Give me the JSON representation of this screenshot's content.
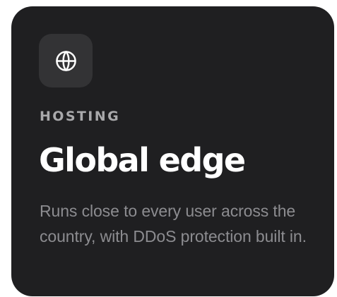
{
  "card": {
    "icon": "globe-icon",
    "eyebrow": "HOSTING",
    "title": "Global edge",
    "description": "Runs close to every user across the country, with DDoS protection built in."
  },
  "colors": {
    "card_background": "#1f1f21",
    "icon_tile_background": "#333335",
    "eyebrow": "#a9a9ab",
    "title": "#ffffff",
    "description": "#8c8c90"
  }
}
